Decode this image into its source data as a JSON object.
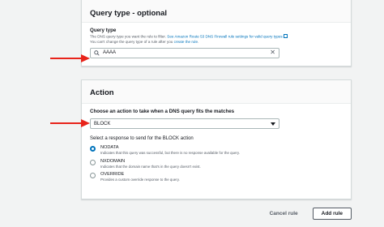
{
  "query_type_section": {
    "title": "Query type - optional",
    "field_label": "Query type",
    "field_desc_prefix": "The DNS query type you want the rule to filter. ",
    "field_desc_link": "See Amazon Route 53 DNS Firewall rule settings for valid query types",
    "field_note_prefix": "You can't change the query type of a rule after you ",
    "field_note_link": "create the rule",
    "field_note_suffix": ".",
    "input_value": "AAAA"
  },
  "action_section": {
    "title": "Action",
    "field_label": "Choose an action to take when a DNS query fits the matches",
    "select_value": "BLOCK",
    "response_label": "Select a response to send for the BLOCK action",
    "options": [
      {
        "title": "NODATA",
        "desc": "Indicates that this query was successful, but there is no response available for the query.",
        "checked": true
      },
      {
        "title": "NXDOMAIN",
        "desc": "Indicates that the domain name that's in the query doesn't exist.",
        "checked": false
      },
      {
        "title": "OVERRIDE",
        "desc": "Provides a custom override response to the query.",
        "checked": false
      }
    ]
  },
  "buttons": {
    "cancel": "Cancel rule",
    "add": "Add rule"
  },
  "colors": {
    "annotation_arrow": "#e8231a",
    "link": "#0073bb"
  }
}
